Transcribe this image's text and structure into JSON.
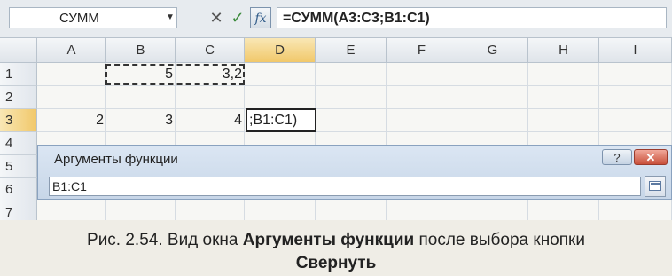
{
  "formula_bar": {
    "name_box": "СУММ",
    "cancel_icon": "✕",
    "enter_icon": "✓",
    "fx_label": "fx",
    "formula": "=СУММ(A3:C3;B1:C1)"
  },
  "columns": [
    "A",
    "B",
    "C",
    "D",
    "E",
    "F",
    "G",
    "H",
    "I"
  ],
  "rows": [
    "1",
    "2",
    "3",
    "4",
    "5",
    "6",
    "7"
  ],
  "cells": {
    "B1": "5",
    "C1": "3,2",
    "A3": "2",
    "B3": "3",
    "C3": "4",
    "D3": ";B1:C1)"
  },
  "dialog": {
    "title": "Аргументы функции",
    "help_label": "?",
    "close_label": "✕",
    "input_value": "B1:C1"
  },
  "caption": {
    "prefix": "Рис. 2.54. Вид окна ",
    "bold1": "Аргументы функции",
    "middle": " после выбора кнопки",
    "bold2": "Свернуть"
  }
}
